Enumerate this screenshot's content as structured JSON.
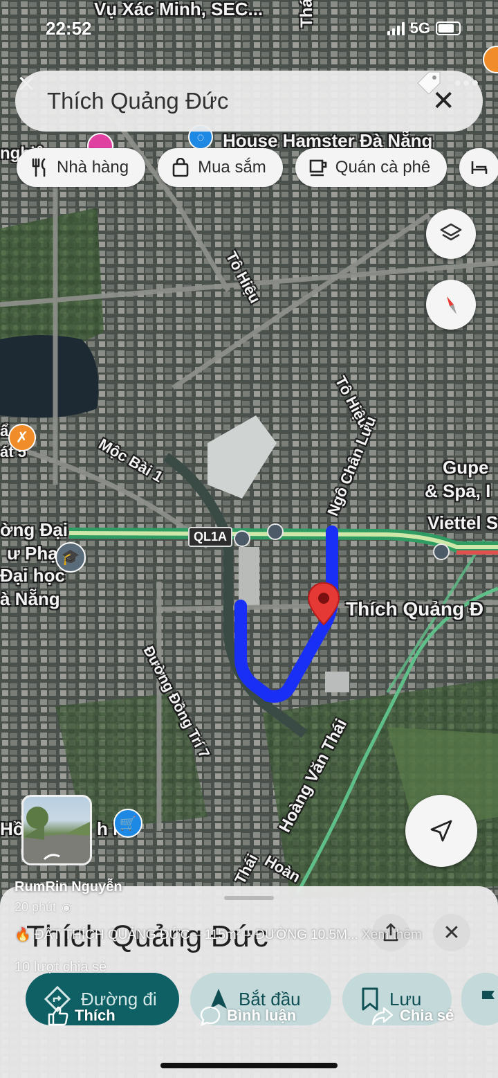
{
  "status_bar": {
    "time": "22:52",
    "network": "5G"
  },
  "search": {
    "query": "Thích Quảng Đức"
  },
  "chips": [
    {
      "label": "Nhà hàng",
      "icon": "fork-knife-icon"
    },
    {
      "label": "Mua sắm",
      "icon": "shopping-bag-icon"
    },
    {
      "label": "Quán cà phê",
      "icon": "coffee-cup-icon"
    }
  ],
  "map": {
    "labels": {
      "top_business": "Vụ Xác Minh, SEC...",
      "thai_to": "Thái Tổ",
      "house_hamster": "House Hamster Đà Nẵng",
      "to_hieu_top": "Tô Hiệu",
      "to_hieu_mid": "Tô Hiệu",
      "moc_bai": "Mộc Bài 1",
      "ngo_chan_luu": "Ngô Chân Lưu",
      "gupe": "Gupe",
      "spa": "& Spa, I",
      "viettel": "Viettel S",
      "ql1a": "QL1A",
      "dai_hoc_1": "ờng Đại",
      "dai_hoc_2": "ư Phạ",
      "dai_hoc_3": "Đại học",
      "dai_hoc_4": "à Nẵng",
      "place_name": "Thích Quảng Đ",
      "dong_tri": "Đường Đồng Trí 7",
      "hoang_van_thai": "Hoàng Văn Thái",
      "thai_bottom": "Thái",
      "hoang_bottom": "Hoàn",
      "ho_minh": "Hồ",
      "minh_suffix": "h Nh",
      "left_edge_1": "ẩ",
      "left_edge_2": "át 5",
      "left_top": "nghiệ"
    },
    "accent_route": "#1a2ff5",
    "pin_color": "#e53935"
  },
  "sheet": {
    "title": "Thích Quảng Đức",
    "actions": [
      {
        "label": "Đường đi",
        "icon": "directions-icon"
      },
      {
        "label": "Bắt đầu",
        "icon": "navigation-arrow-icon"
      },
      {
        "label": "Lưu",
        "icon": "bookmark-icon"
      }
    ]
  },
  "facebook": {
    "author": "RumRin Nguyễn",
    "time": "20 phút",
    "caption": "🔥 ĐẤT THÍCH QUẢNG ĐỨC – 115m² – ĐƯỜNG 10.5M...",
    "more": "Xem thêm",
    "shares": "10 lượt chia sẻ",
    "like": "Thích",
    "comment": "Bình luận",
    "share": "Chia sẻ"
  }
}
